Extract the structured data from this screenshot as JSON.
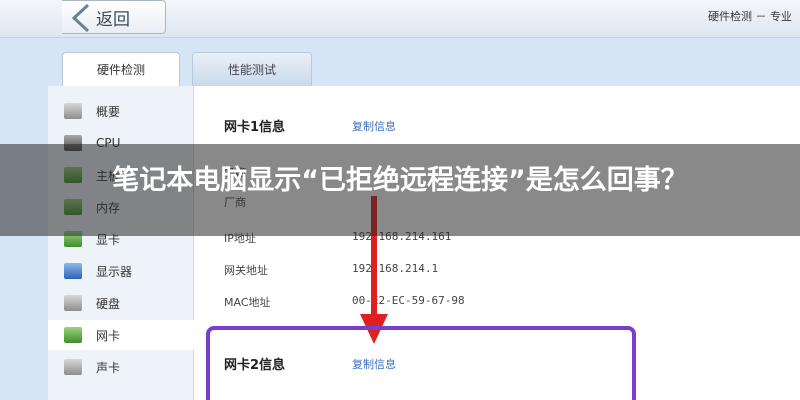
{
  "topbar": {
    "back_label": "返回",
    "right_text": "硬件检测 － 专业"
  },
  "tabs": [
    {
      "label": "硬件检测",
      "active": true
    },
    {
      "label": "性能测试",
      "active": false
    }
  ],
  "sidebar": {
    "items": [
      {
        "label": "概要",
        "icon": "overview-icon"
      },
      {
        "label": "CPU",
        "icon": "cpu-icon"
      },
      {
        "label": "主板",
        "icon": "motherboard-icon"
      },
      {
        "label": "内存",
        "icon": "memory-icon"
      },
      {
        "label": "显卡",
        "icon": "gpu-icon"
      },
      {
        "label": "显示器",
        "icon": "monitor-icon"
      },
      {
        "label": "硬盘",
        "icon": "disk-icon"
      },
      {
        "label": "网卡",
        "icon": "network-card-icon",
        "selected": true
      },
      {
        "label": "声卡",
        "icon": "sound-card-icon"
      }
    ]
  },
  "content": {
    "card1": {
      "title": "网卡1信息",
      "copy_label": "复制信息",
      "rows": [
        {
          "label": "名称",
          "value": ""
        },
        {
          "label": "厂商",
          "value": ""
        },
        {
          "label": "IP地址",
          "value": "192.168.214.161"
        },
        {
          "label": "网关地址",
          "value": "192.168.214.1"
        },
        {
          "label": "MAC地址",
          "value": "00-E2-EC-59-67-98"
        }
      ]
    },
    "card2": {
      "title": "网卡2信息",
      "copy_label": "复制信息"
    }
  },
  "banner": {
    "title": "笔记本电脑显示“已拒绝远程连接”是怎么回事？"
  },
  "colors": {
    "highlight_border": "#7a3fc8",
    "arrow": "#e02020",
    "link": "#3a6fb8"
  }
}
